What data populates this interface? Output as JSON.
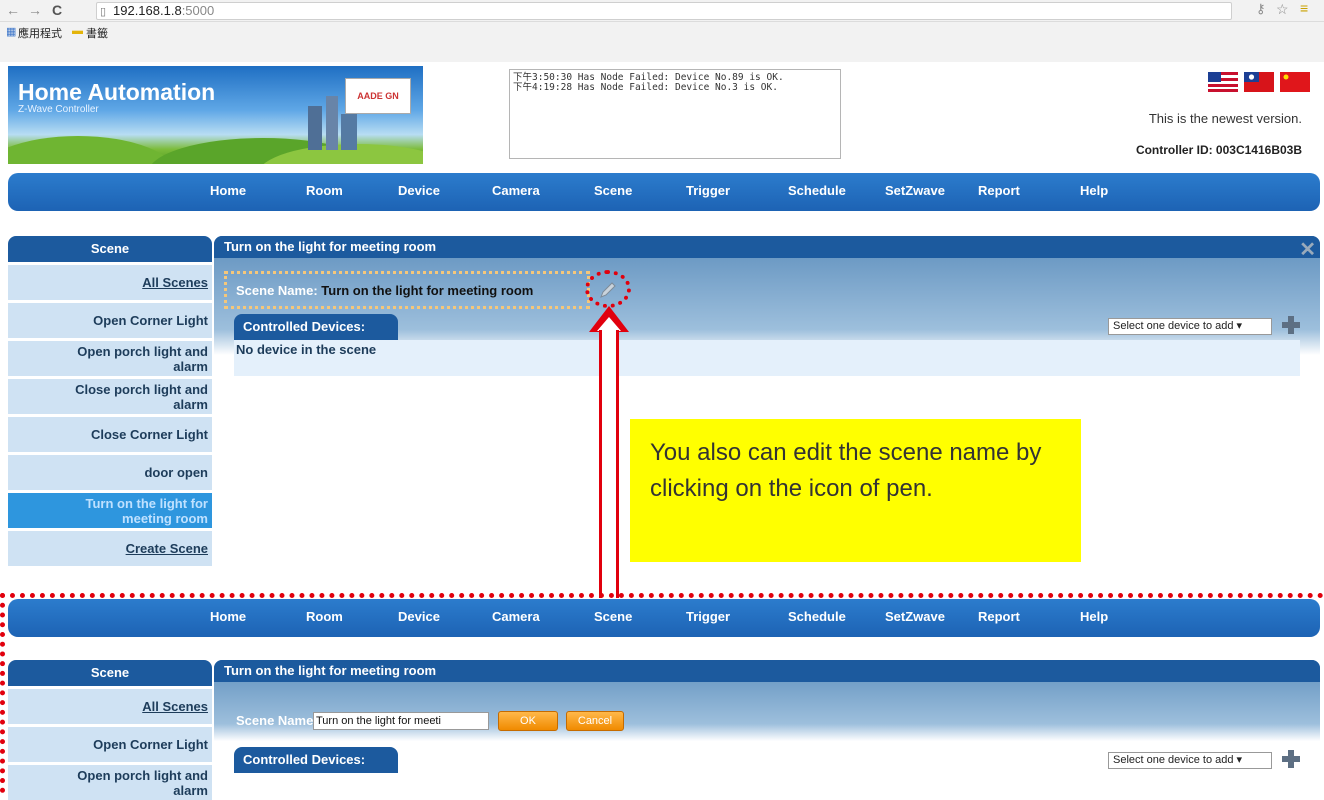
{
  "browser": {
    "url_host": "192.168.1.8",
    "url_port": ":5000",
    "bookmarks": [
      "應用程式",
      "書籤"
    ]
  },
  "header": {
    "title": "Home Automation",
    "subtitle": "Z-Wave Controller",
    "logo_text": "AADE GN",
    "log_lines": [
      "下午3:50:30 Has Node Failed: Device No.89 is OK.",
      "下午4:19:28 Has Node Failed: Device No.3 is OK."
    ],
    "version_text": "This is the newest version.",
    "controller_id": "Controller ID: 003C1416B03B",
    "flags": [
      "us-flag-icon",
      "taiwan-flag-icon",
      "china-flag-icon"
    ]
  },
  "nav": {
    "items": [
      "Home",
      "Room",
      "Device",
      "Camera",
      "Scene",
      "Trigger",
      "Schedule",
      "SetZwave",
      "Report",
      "Help"
    ]
  },
  "sidebar": {
    "title": "Scene",
    "all_scenes": "All Scenes",
    "scenes": [
      "Open Corner Light",
      "Open porch light and alarm",
      "Close porch light and alarm",
      "Close Corner Light",
      "door open",
      "Turn on the light for meeting room"
    ],
    "create_scene": "Create Scene"
  },
  "scene_detail": {
    "title": "Turn on the light for meeting room",
    "scene_name_label": "Scene Name:",
    "scene_name_value": "Turn on the light for meeting room",
    "controlled_devices_label": "Controlled Devices:",
    "no_device_text": "No device in the scene",
    "device_select_placeholder": "Select one device to add"
  },
  "edit_mode": {
    "input_value": "Turn on the light for meeti",
    "ok_label": "OK",
    "cancel_label": "Cancel"
  },
  "annotation": {
    "text": "You also can edit the scene name by clicking on the icon of pen."
  },
  "colors": {
    "nav_blue": "#1d63b4",
    "panel_head": "#1c5a9e",
    "active_item": "#2e96de",
    "annotation_red": "#e1000d",
    "note_yellow": "#ffff00",
    "button_orange": "#f08a00"
  }
}
